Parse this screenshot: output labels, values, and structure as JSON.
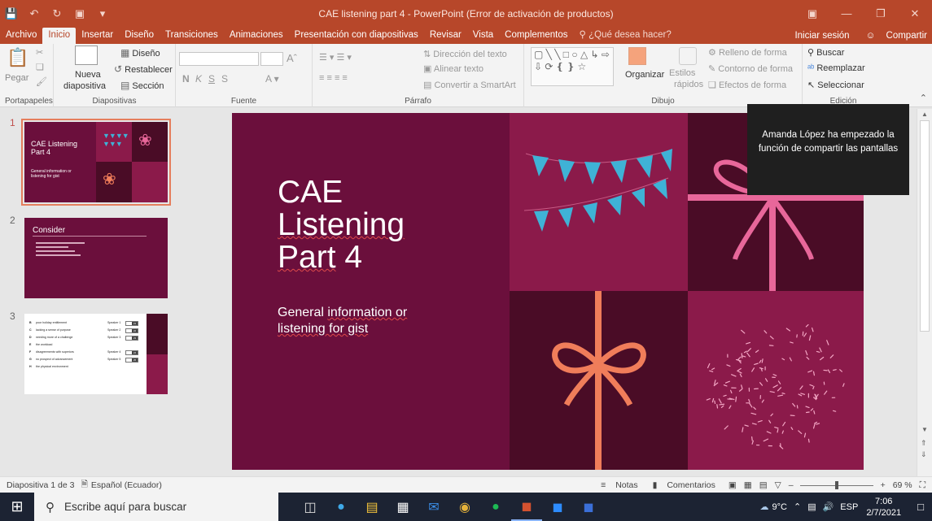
{
  "window": {
    "title": "CAE listening part 4 - PowerPoint (Error de activación de productos)",
    "qat_icons": [
      "save-icon",
      "undo-icon",
      "redo-icon",
      "present-icon",
      "customize-icon"
    ],
    "controls": [
      "ribbon-display-icon",
      "minimize-icon",
      "maximize-icon",
      "close-icon"
    ]
  },
  "menu": {
    "tabs": [
      "Archivo",
      "Inicio",
      "Insertar",
      "Diseño",
      "Transiciones",
      "Animaciones",
      "Presentación con diapositivas",
      "Revisar",
      "Vista",
      "Complementos"
    ],
    "active": "Inicio",
    "tell_me": "¿Qué desea hacer?",
    "signin": "Iniciar sesión",
    "share": "Compartir"
  },
  "ribbon": {
    "clipboard": {
      "paste": "Pegar",
      "label": "Portapapeles"
    },
    "slides": {
      "new_slide_1": "Nueva",
      "new_slide_2": "diapositiva",
      "layout": "Diseño",
      "reset": "Restablecer",
      "section": "Sección",
      "label": "Diapositivas"
    },
    "font": {
      "bold": "N",
      "italic": "K",
      "underline": "S",
      "strike": "S",
      "label": "Fuente"
    },
    "paragraph": {
      "text_direction": "Dirección del texto",
      "align_text": "Alinear texto",
      "smartart": "Convertir a SmartArt",
      "label": "Párrafo"
    },
    "drawing": {
      "arrange": "Organizar",
      "quick_styles_1": "Estilos",
      "quick_styles_2": "rápidos",
      "shape_fill": "Relleno de forma",
      "shape_outline": "Contorno de forma",
      "shape_effects": "Efectos de forma",
      "label": "Dibujo"
    },
    "editing": {
      "find": "Buscar",
      "replace": "Reemplazar",
      "select": "Seleccionar",
      "label": "Edición"
    }
  },
  "thumbnails": [
    {
      "number": "1",
      "title": "CAE Listening Part 4",
      "subtitle": "General information or listening for gist",
      "selected": true
    },
    {
      "number": "2",
      "title": "Consider",
      "selected": false
    },
    {
      "number": "3",
      "selected": false,
      "rows": [
        {
          "letter": "B",
          "text": "poor holiday entitlement",
          "speaker": "Speaker 1",
          "box": "21"
        },
        {
          "letter": "C",
          "text": "lacking a sense of purpose",
          "speaker": "Speaker 2",
          "box": "22"
        },
        {
          "letter": "D",
          "text": "needing more of a challenge",
          "speaker": "Speaker 3",
          "box": "23"
        },
        {
          "letter": "E",
          "text": "the workload",
          "speaker": "",
          "box": ""
        },
        {
          "letter": "F",
          "text": "disagreements with superiors",
          "speaker": "Speaker 4",
          "box": "24"
        },
        {
          "letter": "G",
          "text": "no prospect of advancement",
          "speaker": "Speaker 5",
          "box": "25"
        },
        {
          "letter": "H",
          "text": "the physical environment",
          "speaker": "",
          "box": ""
        }
      ]
    }
  ],
  "slide": {
    "title_line1": "CAE",
    "title_line2": "Listening",
    "title_line3_a": "Part",
    "title_line3_b": " 4",
    "subtitle_a": "General ",
    "subtitle_b": "information or",
    "subtitle_c": "listening for gist",
    "colors": {
      "bg": "#6b0f3c",
      "magenta": "#8b1a4a",
      "dark": "#4a0c26",
      "ribbon_pink": "#e8679a",
      "bow_orange": "#f07d5a",
      "flag_blue": "#3fb2d6"
    }
  },
  "toast": {
    "text": "Amanda López ha empezado la función de compartir las pantallas"
  },
  "status": {
    "slide_info": "Diapositiva 1 de 3",
    "language": "Español (Ecuador)",
    "notes": "Notas",
    "comments": "Comentarios",
    "zoom": "69 %",
    "zoom_fraction": 0.5
  },
  "taskbar": {
    "search_placeholder": "Escribe aquí para buscar",
    "apps": [
      "task-view-icon",
      "edge-icon",
      "file-explorer-icon",
      "store-icon",
      "mail-icon",
      "chrome-icon",
      "spotify-icon",
      "powerpoint-icon",
      "zoom-icon",
      "word-icon"
    ],
    "weather": "9°C",
    "lang": "ESP",
    "time": "7:06",
    "date": "2/7/2021"
  }
}
